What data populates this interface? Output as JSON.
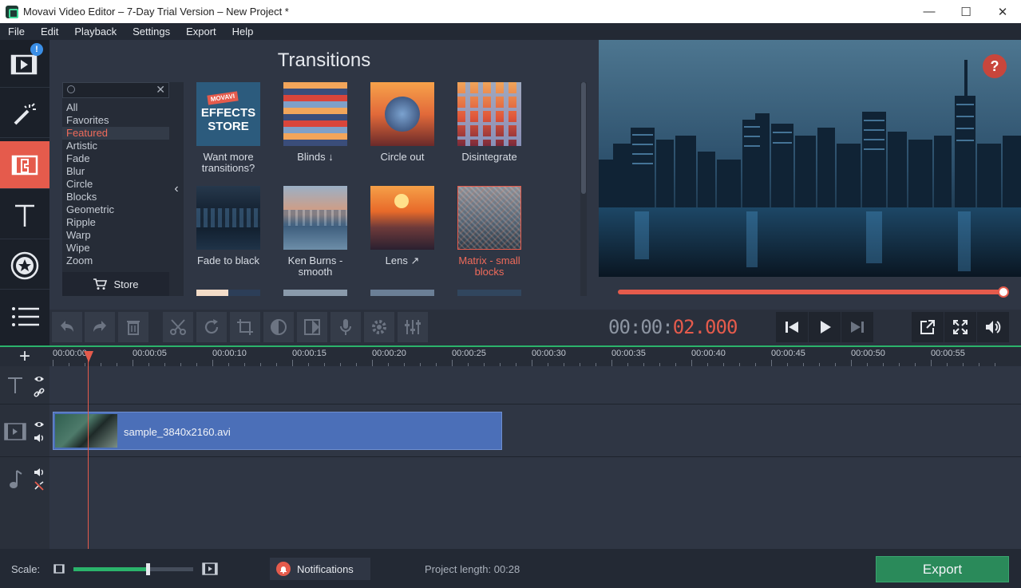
{
  "window": {
    "title": "Movavi Video Editor – 7-Day Trial Version – New Project *",
    "minimize": "—",
    "maximize": "☐",
    "close": "✕"
  },
  "menu": [
    "File",
    "Edit",
    "Playback",
    "Settings",
    "Export",
    "Help"
  ],
  "left_tools": [
    {
      "name": "import-media",
      "badge": "!"
    },
    {
      "name": "filters"
    },
    {
      "name": "transitions",
      "active": true
    },
    {
      "name": "titles"
    },
    {
      "name": "stickers"
    },
    {
      "name": "more-tools"
    }
  ],
  "transitions": {
    "title": "Transitions",
    "search_placeholder": "",
    "search_clear": "✕",
    "categories": [
      "All",
      "Favorites",
      "Featured",
      "Artistic",
      "Fade",
      "Blur",
      "Circle",
      "Blocks",
      "Geometric",
      "Ripple",
      "Warp",
      "Wipe",
      "Zoom"
    ],
    "selected_category": "Featured",
    "store_label": "Store",
    "collapse_arrow": "‹",
    "store_tile": {
      "brand": "MOVAVI",
      "line1": "EFFECTS",
      "line2": "STORE"
    },
    "tiles": [
      {
        "label": "Want more transitions?",
        "selected": false
      },
      {
        "label": "Blinds ↓",
        "selected": false
      },
      {
        "label": "Circle out",
        "selected": false
      },
      {
        "label": "Disintegrate",
        "selected": false
      },
      {
        "label": "Fade to black",
        "selected": false
      },
      {
        "label": "Ken Burns - smooth",
        "selected": false
      },
      {
        "label": "Lens ↗",
        "selected": false
      },
      {
        "label": "Matrix - small blocks",
        "selected": true
      }
    ]
  },
  "preview": {
    "help": "?",
    "progress_fraction": 1.0
  },
  "timecode": {
    "grey": "00:00:",
    "red": "02.000"
  },
  "ruler": [
    "00:00:00",
    "00:00:05",
    "00:00:10",
    "00:00:15",
    "00:00:20",
    "00:00:25",
    "00:00:30",
    "00:00:35",
    "00:00:40",
    "00:00:45",
    "00:00:50",
    "00:00:55"
  ],
  "timeline": {
    "add_track": "+",
    "clip_name": "sample_3840x2160.avi"
  },
  "status": {
    "scale_label": "Scale:",
    "scale_fraction": 0.62,
    "notifications": "Notifications",
    "project_length": "Project length:  00:28",
    "export": "Export"
  },
  "colors": {
    "accent": "#e55b4c",
    "green": "#2bb36b",
    "clip": "#4b6fb8"
  }
}
